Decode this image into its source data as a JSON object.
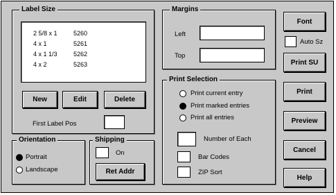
{
  "label_size": {
    "title": "Label Size",
    "items": [
      {
        "size": "2 5/8 x 1",
        "code": "5260"
      },
      {
        "size": "4 x 1",
        "code": "5261"
      },
      {
        "size": "4 x 1 1/3",
        "code": "5262"
      },
      {
        "size": "4 x 2",
        "code": "5263"
      }
    ],
    "new_label": "New",
    "edit_label": "Edit",
    "delete_label": "Delete",
    "first_label_pos": "First Label Pos",
    "first_label_pos_value": ""
  },
  "margins": {
    "title": "Margins",
    "left_label": "Left",
    "top_label": "Top",
    "left_value": "",
    "top_value": ""
  },
  "print_selection": {
    "title": "Print Selection",
    "options": [
      {
        "label": "Print current entry",
        "selected": false
      },
      {
        "label": "Print marked entries",
        "selected": true
      },
      {
        "label": "Print all entries",
        "selected": false
      }
    ],
    "number_of_each": "Number of Each",
    "number_of_each_value": "",
    "bar_codes": "Bar Codes",
    "zip_sort": "ZIP Sort"
  },
  "orientation": {
    "title": "Orientation",
    "portrait": "Portrait",
    "landscape": "Landscape",
    "selected": "portrait"
  },
  "shipping": {
    "title": "Shipping",
    "on_label": "On",
    "ret_addr": "Ret Addr"
  },
  "right_buttons": {
    "font": "Font",
    "auto_sz": "Auto Sz",
    "print_su": "Print SU",
    "print": "Print",
    "preview": "Preview",
    "cancel": "Cancel",
    "help": "Help"
  }
}
